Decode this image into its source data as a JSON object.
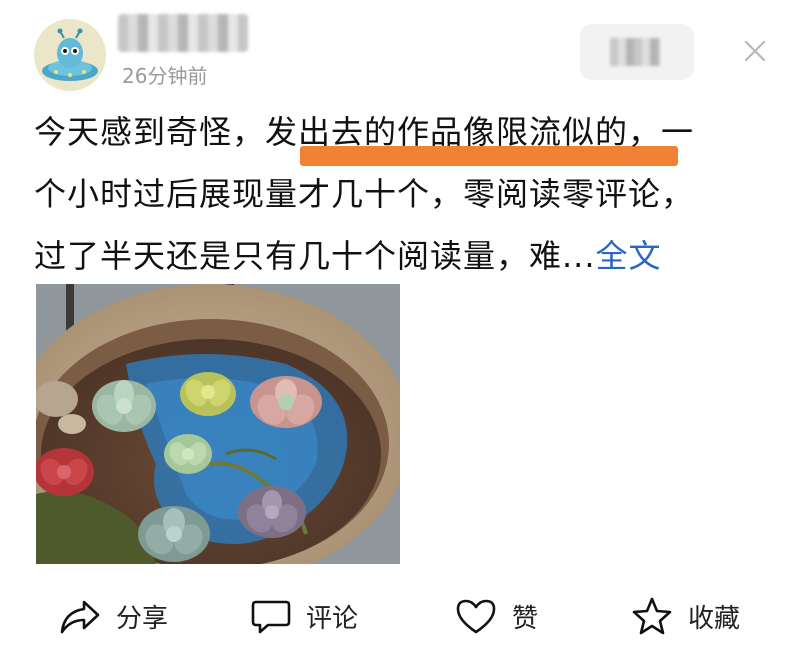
{
  "header": {
    "time_ago": "26分钟前",
    "close_icon": "close-icon",
    "avatar_icon": "alien-avatar"
  },
  "post": {
    "line1_a": "今天感到奇怪，",
    "line1_b": "发出去的作品像限流似的",
    "line1_c": "，一",
    "line2": "个小时过后展现量才几十个，零阅读零评论，",
    "line3": "过了半天还是只有几十个阅读量，难...",
    "more": "全文",
    "highlight_color": "#f07a2a",
    "link_color": "#2b66c2"
  },
  "actions": {
    "share": "分享",
    "comment": "评论",
    "like": "赞",
    "favorite": "收藏"
  }
}
